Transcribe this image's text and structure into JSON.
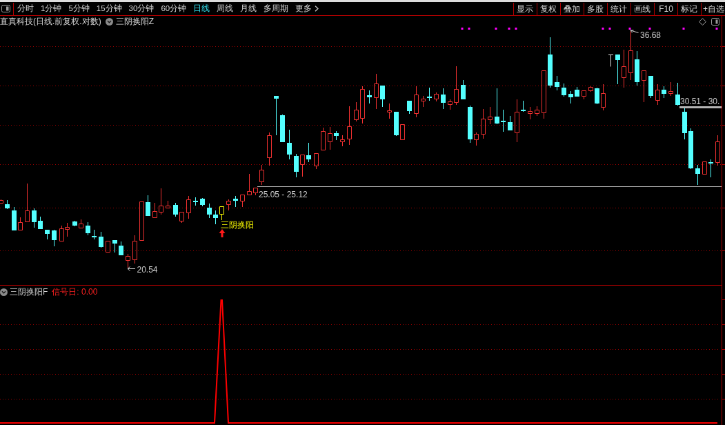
{
  "toolbar": {
    "periods": [
      {
        "label": "分时",
        "selected": false
      },
      {
        "label": "1分钟",
        "selected": false
      },
      {
        "label": "5分钟",
        "selected": false
      },
      {
        "label": "15分钟",
        "selected": false
      },
      {
        "label": "30分钟",
        "selected": false
      },
      {
        "label": "60分钟",
        "selected": false
      },
      {
        "label": "日线",
        "selected": true
      },
      {
        "label": "周线",
        "selected": false
      },
      {
        "label": "月线",
        "selected": false
      },
      {
        "label": "多周期",
        "selected": false
      }
    ],
    "more": {
      "label": "更多"
    },
    "tools": [
      "显示",
      "复权",
      "叠加",
      "多股",
      "统计",
      "画线",
      "F10",
      "标记",
      "+自选"
    ]
  },
  "price_panel": {
    "security": "直真科技(日线.前复权.对数)",
    "indicator": "三阴换阳Z",
    "high_label": "36.68",
    "low_label": "20.54",
    "range_labels": [
      "25.05 - 25.12",
      "30.51 - 30."
    ],
    "signal_label": "三阴换阳"
  },
  "indicator_panel": {
    "name": "三阴换阳F",
    "value_label": "信号日: 0.00"
  }
}
